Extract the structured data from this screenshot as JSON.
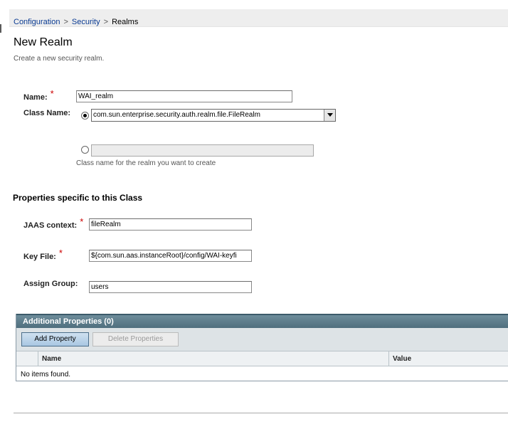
{
  "breadcrumb": {
    "items": [
      "Configuration",
      "Security"
    ],
    "separator": ">",
    "current": "Realms"
  },
  "page": {
    "title": "New Realm",
    "description": "Create a new security realm."
  },
  "form": {
    "name": {
      "label": "Name:",
      "required_mark": "*",
      "value": "WAI_realm"
    },
    "class_name": {
      "label": "Class Name:",
      "selected_option": "com.sun.enterprise.security.auth.realm.file.FileRealm",
      "custom_value": "",
      "hint": "Class name for the realm you want to create"
    }
  },
  "properties_section": {
    "title": "Properties specific to this Class",
    "jaas_context": {
      "label": "JAAS context:",
      "required_mark": "*",
      "value": "fileRealm"
    },
    "key_file": {
      "label": "Key File:",
      "required_mark": "*",
      "value": "${com.sun.aas.instanceRoot}/config/WAI-keyfi"
    },
    "assign_group": {
      "label": "Assign Group:",
      "value": "users"
    }
  },
  "additional_properties": {
    "title": "Additional Properties (0)",
    "add_button": "Add Property",
    "delete_button": "Delete Properties",
    "columns": [
      "Name",
      "Value"
    ],
    "empty_message": "No items found."
  },
  "colors": {
    "link": "#0a3b93",
    "required": "#cc0000",
    "table_header": "#4f6f7e"
  }
}
